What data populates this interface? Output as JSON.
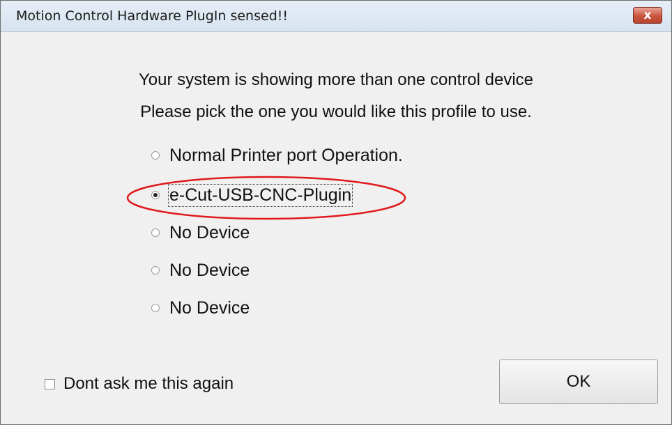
{
  "window": {
    "title": "Motion Control Hardware PlugIn sensed!!",
    "close_glyph": "x"
  },
  "message": {
    "line1": "Your system is showing more than one control device",
    "line2": "Please pick the one you would like this profile to use."
  },
  "options": [
    {
      "label": "Normal Printer port Operation.",
      "checked": false
    },
    {
      "label": "e-Cut-USB-CNC-Plugin",
      "checked": true
    },
    {
      "label": "No Device",
      "checked": false
    },
    {
      "label": "No Device",
      "checked": false
    },
    {
      "label": "No Device",
      "checked": false
    }
  ],
  "dont_ask": {
    "label": "Dont ask me this again",
    "checked": false
  },
  "ok_button": {
    "label": "OK"
  },
  "colors": {
    "annotation": "#e0191c"
  }
}
